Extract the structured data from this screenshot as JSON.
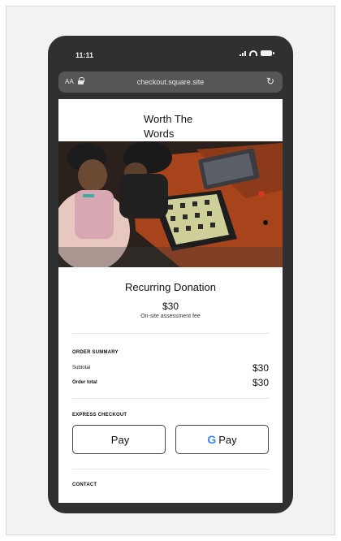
{
  "status_bar": {
    "time": "11:11"
  },
  "url_bar": {
    "text_size_label": "AA",
    "url": "checkout.square.site",
    "reload_glyph": "↻"
  },
  "brand": {
    "name": "Worth The Words"
  },
  "product": {
    "title": "Recurring Donation",
    "price": "$30",
    "note": "On-site assessment fee"
  },
  "order_summary": {
    "heading": "ORDER SUMMARY",
    "rows": [
      {
        "label": "Subtotal",
        "value": "$30"
      },
      {
        "label": "Order total",
        "value": "$30"
      }
    ]
  },
  "express_checkout": {
    "heading": "EXPRESS CHECKOUT",
    "apple_pay": {
      "glyph": "",
      "label": "Pay"
    },
    "google_pay": {
      "glyph": "G",
      "label": "Pay"
    }
  },
  "contact": {
    "heading": "CONTACT"
  },
  "colors": {
    "phone_body": "#2f3031",
    "url_bar": "#555657",
    "frame_bg": "#f3f2f0",
    "google_blue": "#4285f4"
  }
}
